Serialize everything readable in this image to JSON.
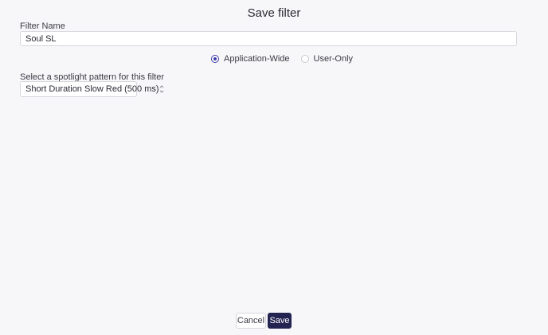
{
  "dialog": {
    "title": "Save filter"
  },
  "filter_name": {
    "label": "Filter Name",
    "value": "Soul SL"
  },
  "scope": {
    "options": [
      {
        "label": "Application-Wide",
        "checked": true
      },
      {
        "label": "User-Only",
        "checked": false
      }
    ]
  },
  "spotlight": {
    "label": "Select a spotlight pattern for this filter",
    "selected": "Short Duration Slow Red (500 ms)"
  },
  "footer": {
    "cancel_label": "Cancel",
    "save_label": "Save"
  },
  "colors": {
    "accent": "#3c3aa8",
    "save_button_bg": "#242452",
    "background": "#f7f7f9"
  }
}
